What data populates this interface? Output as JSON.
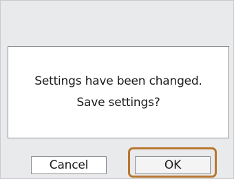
{
  "dialog": {
    "message_line1": "Settings have been changed.",
    "message_line2": "Save settings?",
    "cancel_label": "Cancel",
    "ok_label": "OK",
    "selected_button": "OK"
  },
  "colors": {
    "background": "#e9eaec",
    "message_box": "#ffffff",
    "focus_ring": "#b8762e",
    "text": "#1b1b1b"
  }
}
